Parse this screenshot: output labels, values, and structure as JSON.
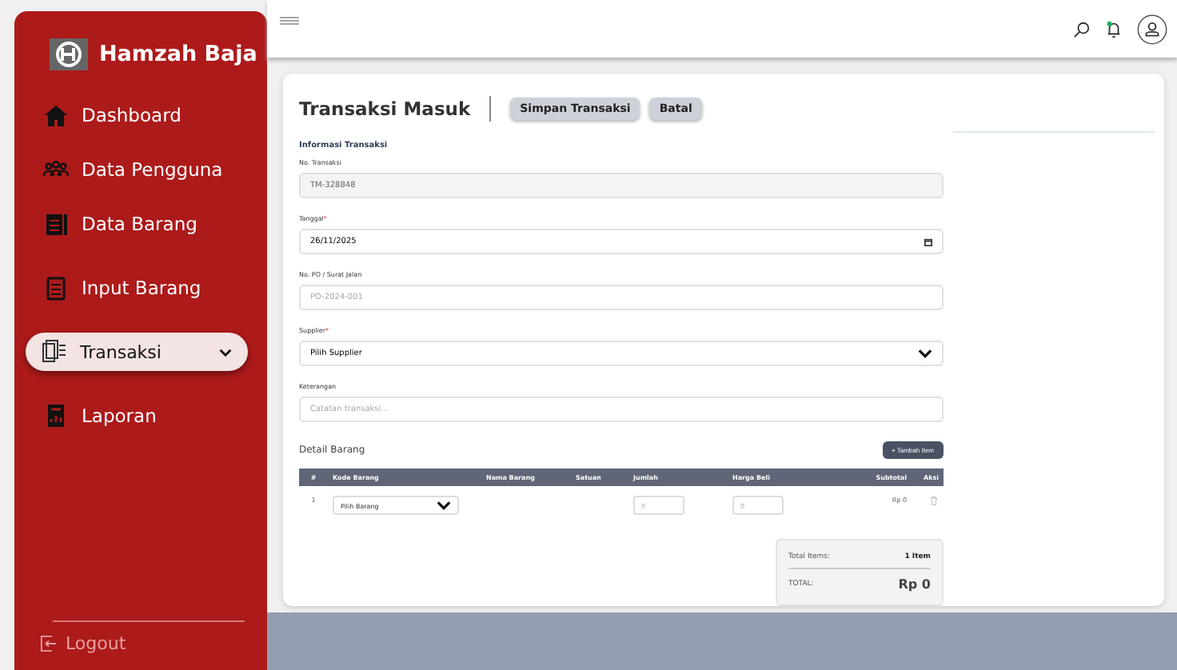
{
  "brand": {
    "name": "Hamzah Baja"
  },
  "nav": [
    {
      "label": "Dashboard",
      "selected": false,
      "has_submenu": false
    },
    {
      "label": "Data Pengguna",
      "selected": false,
      "has_submenu": false
    },
    {
      "label": "Data Barang",
      "selected": false,
      "has_submenu": false
    },
    {
      "label": "Input Barang",
      "selected": false,
      "has_submenu": false
    },
    {
      "label": "Transaksi",
      "selected": true,
      "has_submenu": true
    },
    {
      "label": "Laporan",
      "selected": false,
      "has_submenu": false
    }
  ],
  "required_mark": "*",
  "logout": {
    "label": "Logout"
  },
  "notification": {
    "unread": true
  },
  "page": {
    "title": "Transaksi Masuk",
    "actions": [
      "Simpan Transaksi",
      "Batal"
    ]
  },
  "section": {
    "title": "Informasi Transaksi"
  },
  "fields": [
    {
      "label": "No. Transaksi",
      "required": false,
      "kind": "text",
      "readonly": true,
      "value": "TM-328848"
    },
    {
      "label": "Tanggal",
      "required": true,
      "kind": "date",
      "readonly": false,
      "value": "26/11/2025"
    },
    {
      "label": "No. PO / Surat Jalan",
      "required": false,
      "kind": "text",
      "readonly": false,
      "placeholder": "PO-2024-001"
    },
    {
      "label": "Supplier",
      "required": true,
      "kind": "select",
      "readonly": false,
      "value": "Pilih Supplier"
    },
    {
      "label": "Keterangan",
      "required": false,
      "kind": "text",
      "readonly": false,
      "placeholder": "Catatan transaksi..."
    }
  ],
  "detail": {
    "title": "Detail Barang",
    "add_button": "+ Tambah Item",
    "columns": [
      "#",
      "Kode Barang",
      "Nama Barang",
      "Satuan",
      "Jumlah",
      "Harga Beli",
      "Subtotal",
      "Aksi"
    ],
    "rows": [
      {
        "no": "1",
        "kode": "Pilih Barang",
        "jumlah": "0",
        "harga": "0",
        "subtotal": "Rp 0"
      }
    ]
  },
  "summary": {
    "items_label": "Total Items:",
    "items_value": "1 Item",
    "total_label": "TOTAL:",
    "total_value": "Rp 0"
  }
}
